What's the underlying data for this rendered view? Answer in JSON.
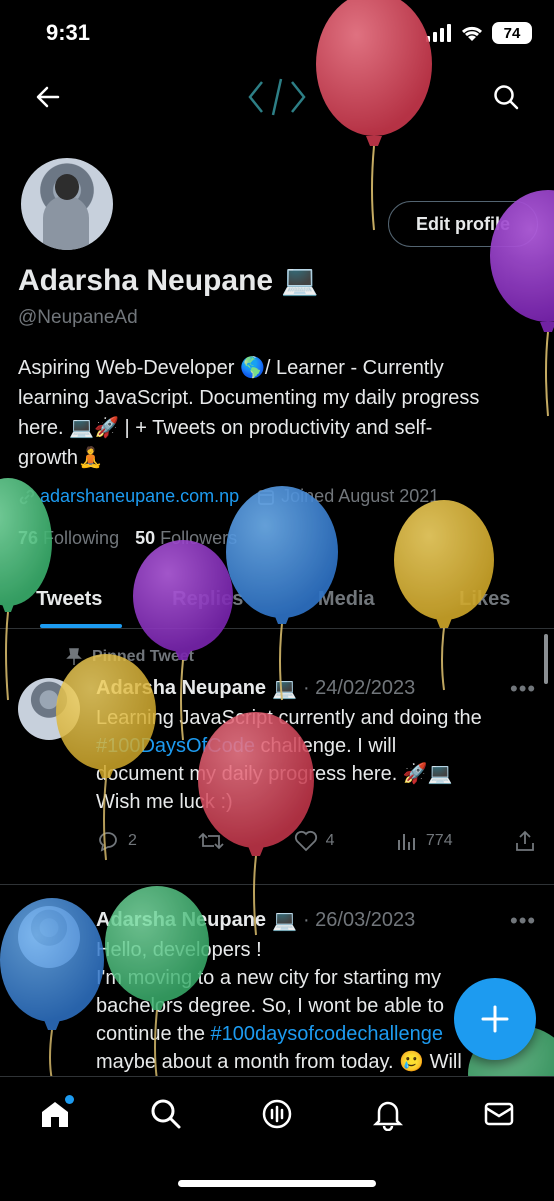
{
  "status_bar": {
    "time": "9:31",
    "battery": "74"
  },
  "header": {
    "back_icon": "arrow-left-icon",
    "logo_icon": "code-brackets-icon",
    "search_icon": "search-icon"
  },
  "profile": {
    "edit_button": "Edit profile",
    "name": "Adarsha Neupane",
    "name_emoji": "💻",
    "handle": "@NeupaneAd",
    "bio_lines": [
      "Aspiring Web-Developer 🌎/ Learner - Currently",
      "learning JavaScript. Documenting my daily progress",
      "here. 💻🚀 | + Tweets on productivity and self-",
      "growth🧘"
    ],
    "website": "adarshaneupane.com.np",
    "joined": "Joined August 2021",
    "following_count": "76",
    "following_label": "Following",
    "followers_count": "50",
    "followers_label": "Followers"
  },
  "tabs": [
    "Tweets",
    "Replies",
    "Media",
    "Likes"
  ],
  "active_tab": "Tweets",
  "tweets": [
    {
      "pinned_label": "Pinned Tweet",
      "author": "Adarsha Neupane",
      "emoji": "💻",
      "date": "· 24/02/2023",
      "text_1": "Learning JavaScript currently and doing the",
      "hashtag": "#100DaysOfCode",
      "text_2": " challenge. I will",
      "text_3": "document my daily progress here. 🚀💻",
      "text_4": "Wish me luck :)",
      "replies": "2",
      "retweets": "",
      "likes": "4",
      "views": "774"
    },
    {
      "author": "Adarsha Neupane",
      "emoji": "💻",
      "date": "· 26/03/2023",
      "text_1": "Hello, developers !",
      "text_2": "I'm moving to a new city for starting my",
      "text_3": "bachelors degree. So, I wont be able to",
      "text_4_pre": "continue the ",
      "hashtag": "#100daysofcodechallenge",
      "text_5": "maybe about a month from today. 🥲 Will"
    }
  ],
  "bottom_nav": [
    "home-icon",
    "search-icon",
    "spaces-icon",
    "notifications-bell-icon",
    "messages-envelope-icon"
  ],
  "colors": {
    "accent": "#1d9bf0",
    "background": "#000000",
    "muted": "#71767b",
    "text": "#e7e9ea"
  }
}
